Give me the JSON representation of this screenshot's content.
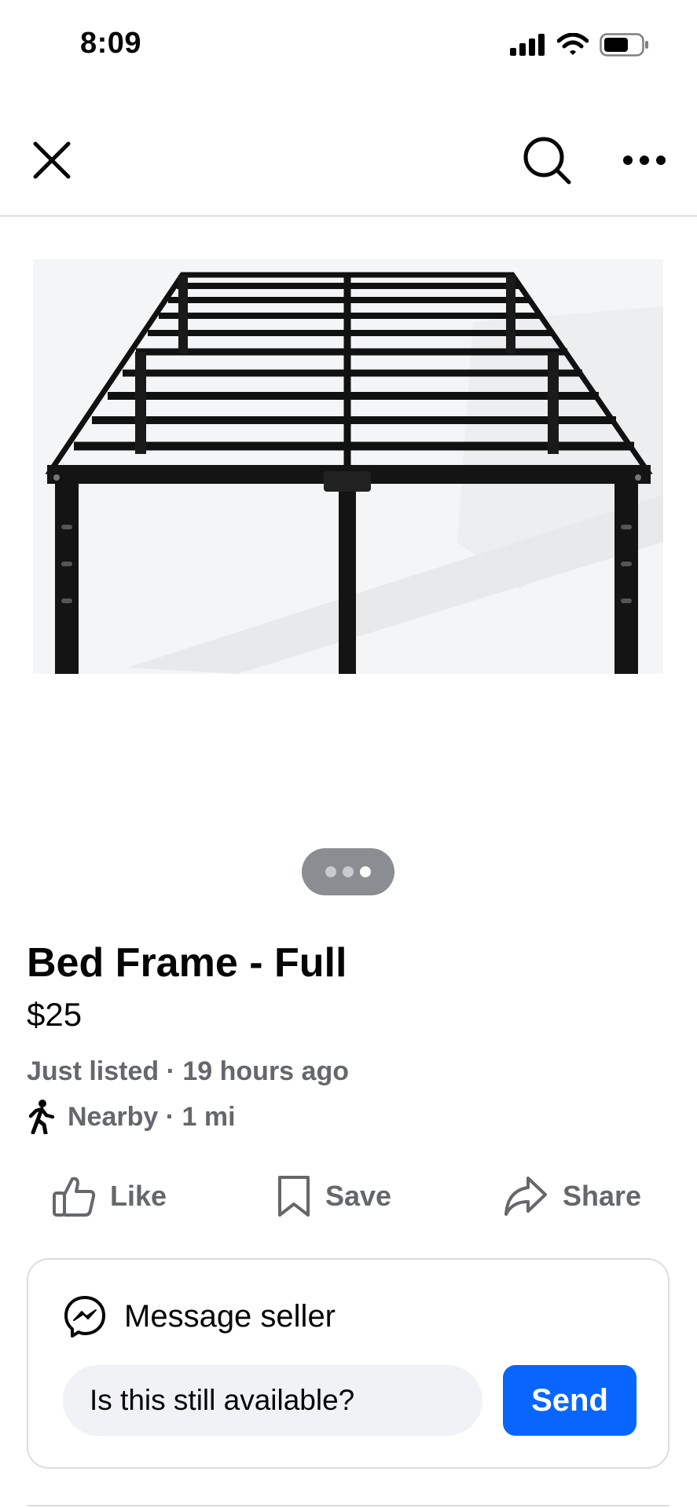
{
  "status_bar": {
    "time": "8:09",
    "icons": [
      "signal-icon",
      "wifi-icon",
      "battery-icon"
    ]
  },
  "nav": {
    "icons": [
      "close-icon",
      "search-icon",
      "more-icon"
    ]
  },
  "gallery": {
    "image": "bed-frame-photo",
    "page_count": 3,
    "active_page": 3
  },
  "listing": {
    "title": "Bed Frame - Full",
    "price": "$25",
    "listed": "Just listed · 19 hours ago",
    "distance": "Nearby · 1 mi"
  },
  "actions": {
    "like": "Like",
    "save": "Save",
    "share": "Share"
  },
  "message": {
    "title": "Message seller",
    "input_value": "Is this still available?",
    "send": "Send"
  },
  "colors": {
    "accent": "#0866ff",
    "secondary_text": "#65676b",
    "input_bg": "#f0f2f5",
    "divider": "#dadde1"
  }
}
